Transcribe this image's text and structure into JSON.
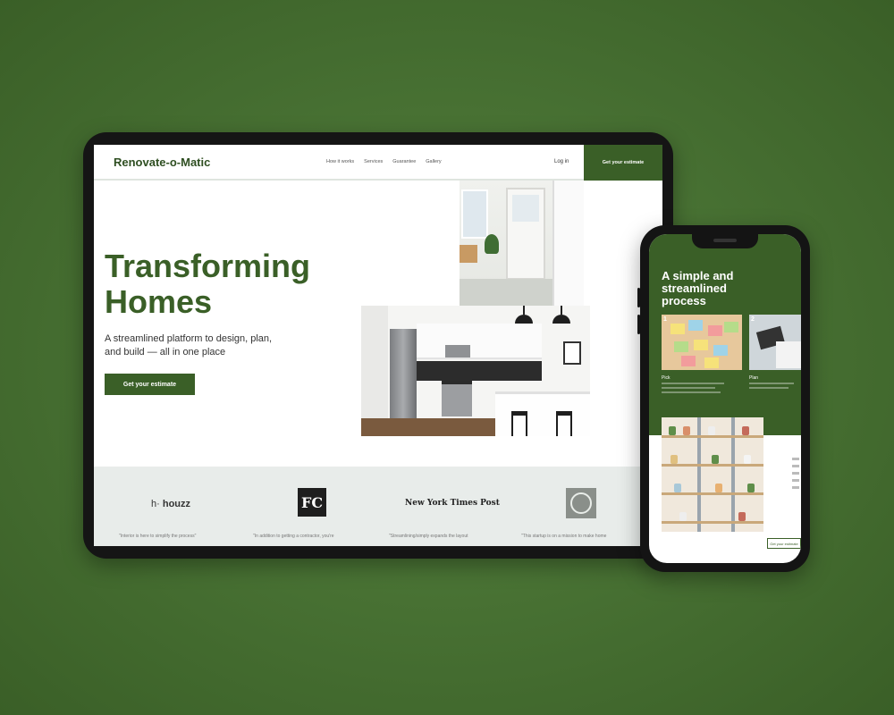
{
  "tablet": {
    "brand": "Renovate-o-Matic",
    "nav": [
      "How it works",
      "Services",
      "Guarantee",
      "Gallery"
    ],
    "login": "Log in",
    "cta_top": "Get your estimate",
    "hero_title_line1": "Transforming",
    "hero_title_line2": "Homes",
    "hero_subtitle": "A streamlined platform to design, plan, and build — all in one place",
    "hero_button": "Get your estimate",
    "press": {
      "houzz": "houzz",
      "fc": "FC",
      "nyp": "New York Times Post",
      "quotes": [
        "\"Interior is here to simplify the process\"",
        "\"In addition to getting a contractor, you're",
        "\"Streamlining/simply expands the layout",
        "\"This startup is on a mission to make home"
      ]
    }
  },
  "phone": {
    "title": "A simple and streamlined process",
    "step1_num": "1",
    "step1_label": "Pick",
    "step2_num": "2",
    "step2_label": "Plan",
    "button": "Get your estimate"
  },
  "colors": {
    "brand_green": "#3a5f27",
    "background": "#4a7435"
  },
  "icons": [
    "houzz-logo",
    "fc-logo",
    "nyp-logo",
    "badge-logo"
  ]
}
